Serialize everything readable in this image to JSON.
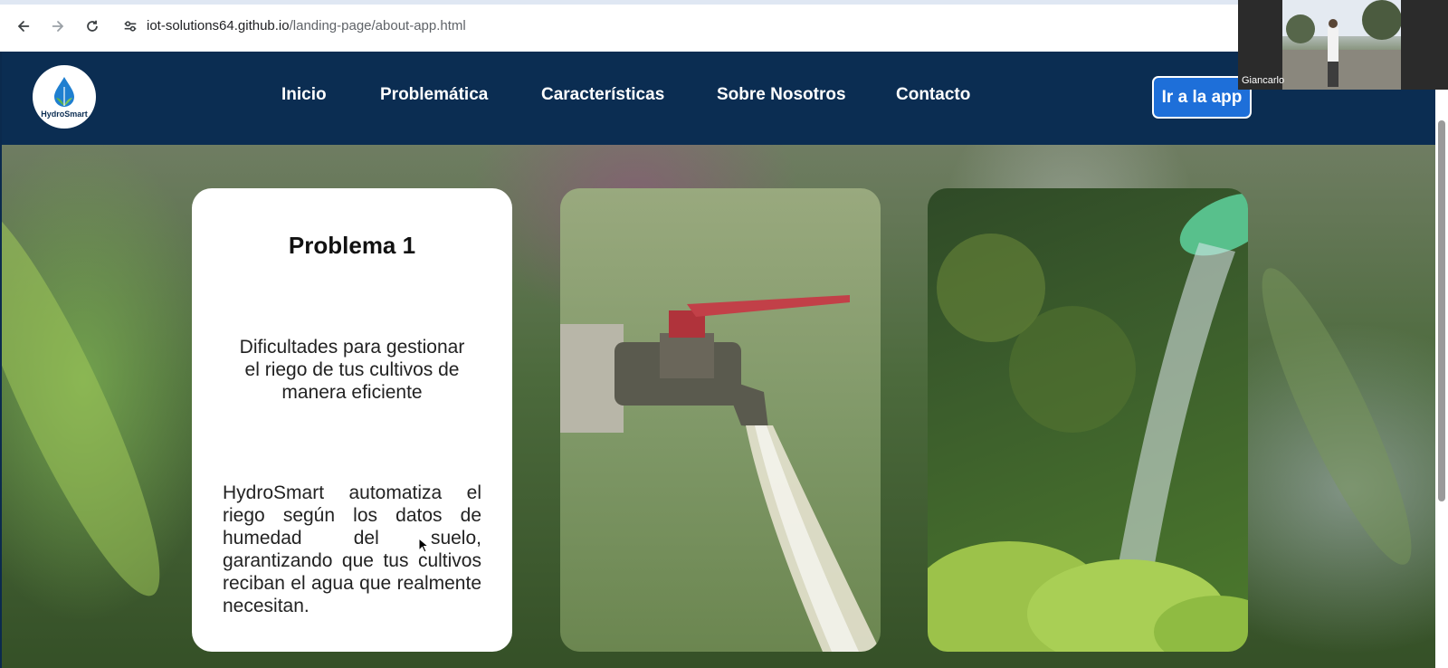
{
  "browser": {
    "url_host": "iot-solutions64.github.io",
    "url_path": "/landing-page/about-app.html"
  },
  "site": {
    "logo_text": "HydroSmart",
    "nav": [
      "Inicio",
      "Problemática",
      "Características",
      "Sobre Nosotros",
      "Contacto"
    ],
    "cta_label": "Ir a la app"
  },
  "problem_card": {
    "title": "Problema 1",
    "subtitle": "Dificultades para gestionar el riego de tus cultivos de manera eficiente",
    "body": "HydroSmart automatiza el riego según los datos de humedad del suelo, garantizando que tus cultivos reciban el agua que realmente necesitan."
  },
  "video_call": {
    "participant_name": "Giancarlo"
  },
  "colors": {
    "header_bg": "#0b2d52",
    "cta_bg": "#1e6fd9"
  }
}
